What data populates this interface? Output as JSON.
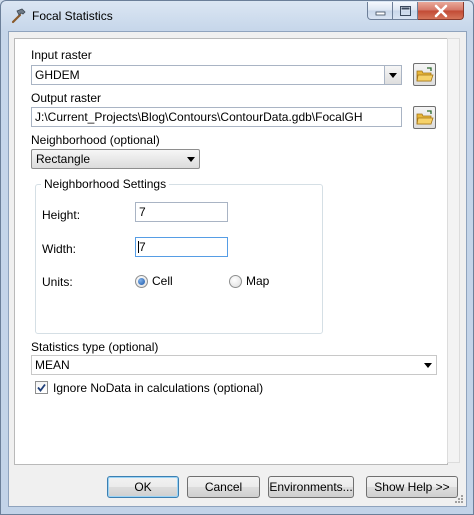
{
  "window": {
    "title": "Focal Statistics",
    "title_icon": "hammer-icon",
    "controls": [
      "minimize-icon",
      "maximize-icon",
      "close-icon"
    ]
  },
  "input_raster": {
    "label": "Input raster",
    "value": "GHDEM"
  },
  "output_raster": {
    "label": "Output raster",
    "value": "J:\\Current_Projects\\Blog\\Contours\\ContourData.gdb\\FocalGH"
  },
  "neighborhood": {
    "label": "Neighborhood (optional)",
    "value": "Rectangle"
  },
  "neighborhood_settings": {
    "title": "Neighborhood Settings",
    "height_label": "Height:",
    "height_value": "7",
    "width_label": "Width:",
    "width_value": "7",
    "units_label": "Units:",
    "units_options": [
      "Cell",
      "Map"
    ],
    "units_selected": "Cell"
  },
  "statistics_type": {
    "label": "Statistics type (optional)",
    "value": "MEAN"
  },
  "ignore_nodata": {
    "label": "Ignore NoData in calculations (optional)",
    "checked": true
  },
  "buttons": {
    "ok": "OK",
    "cancel": "Cancel",
    "environments": "Environments...",
    "show_help": "Show Help >>"
  },
  "colors": {
    "accent": "#3c7fb1",
    "close_button": "#c24a34",
    "folder": "#e8b73a"
  }
}
